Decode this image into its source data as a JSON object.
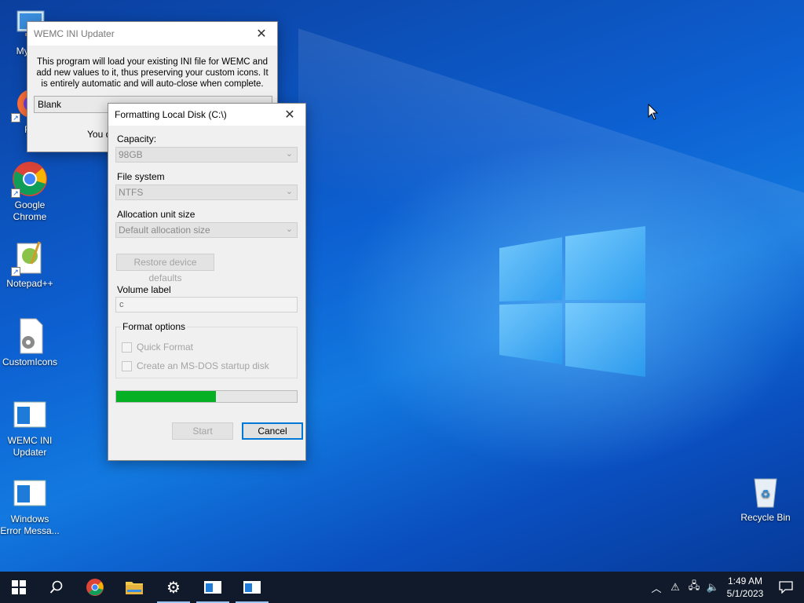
{
  "desktop": {
    "icons": [
      {
        "label": "My Co",
        "icon": "my-computer-icon"
      },
      {
        "label": "Fir",
        "icon": "firefox-icon"
      },
      {
        "label": "Google Chrome",
        "icon": "chrome-icon"
      },
      {
        "label": "Notepad++",
        "icon": "notepadpp-icon"
      },
      {
        "label": "CustomIcons",
        "icon": "settings-file-icon"
      },
      {
        "label": "WEMC INI Updater",
        "icon": "app-window-icon"
      },
      {
        "label": "Windows Error Messa...",
        "icon": "app-window-icon"
      },
      {
        "label": "Recycle Bin",
        "icon": "recycle-bin-icon"
      }
    ]
  },
  "wemc_window": {
    "title": "WEMC INI Updater",
    "description": "This program will load your existing INI file for WEMC and add new values to it, thus preserving your custom icons. It is entirely automatic and will auto-close when complete.",
    "select_value": "Blank",
    "partial_text": "You d"
  },
  "format_window": {
    "title": "Formatting Local Disk (C:\\)",
    "capacity_label": "Capacity:",
    "capacity_value": "98GB",
    "filesystem_label": "File system",
    "filesystem_value": "NTFS",
    "allocation_label": "Allocation unit size",
    "allocation_value": "Default allocation size",
    "restore_button": "Restore device defaults",
    "volume_label": "Volume label",
    "volume_value": "c",
    "format_options_label": "Format options",
    "quick_format_label": "Quick Format",
    "msdos_label": "Create an MS-DOS startup disk",
    "progress_percent": 55,
    "start_button": "Start",
    "cancel_button": "Cancel"
  },
  "taskbar": {
    "clock_time": "1:49 AM",
    "clock_date": "5/1/2023",
    "accent": "#0078d7",
    "progress_color": "#06b025"
  }
}
